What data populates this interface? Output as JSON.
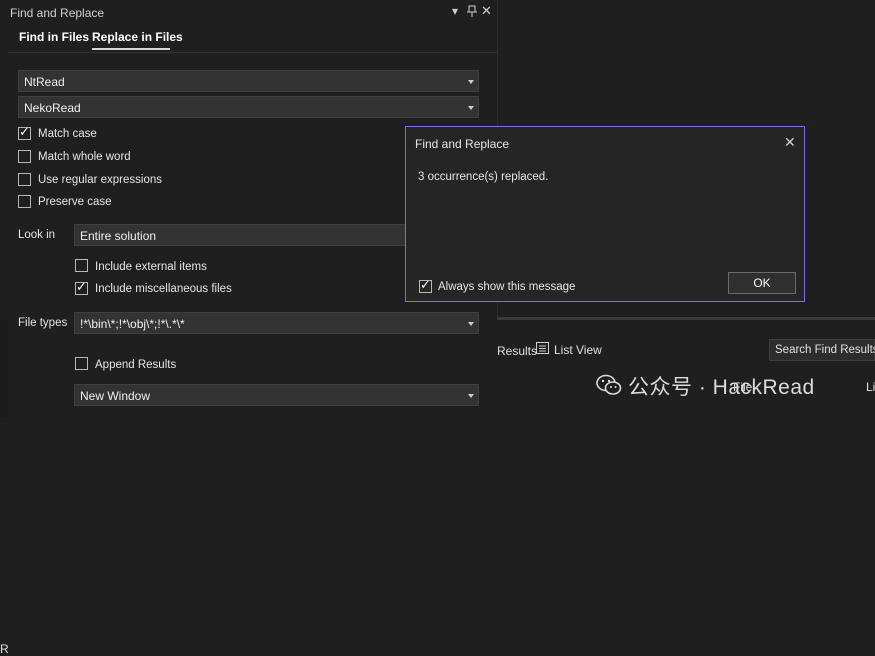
{
  "panel": {
    "title": "Find and Replace",
    "tabs": [
      "Find in Files",
      "Replace in Files"
    ],
    "find_value": "NtRead",
    "replace_value": "NekoRead",
    "options": [
      {
        "label": "Match case",
        "checked": true
      },
      {
        "label": "Match whole word",
        "checked": false
      },
      {
        "label": "Use regular expressions",
        "checked": false
      },
      {
        "label": "Preserve case",
        "checked": false
      }
    ],
    "look_in_label": "Look in",
    "look_in_value": "Entire solution",
    "include_external": {
      "label": "Include external items",
      "checked": false
    },
    "include_misc": {
      "label": "Include miscellaneous files",
      "checked": true
    },
    "file_types_label": "File types",
    "file_types_value": "!*\\bin\\*;!*\\obj\\*;!*\\.*\\*",
    "append_results": {
      "label": "Append Results",
      "checked": false
    },
    "output_value": "New Window"
  },
  "bottom": {
    "results_fragment": "Results",
    "list_view_label": "List View",
    "search_results_label": "Search Find Results",
    "file_column": "File",
    "edge_fragment_right": "Li",
    "edge_fragment_left": "R"
  },
  "dialog": {
    "title": "Find and Replace",
    "message": "3 occurrence(s) replaced.",
    "always_show_label": "Always show this message",
    "always_show_checked": true,
    "ok_label": "OK"
  },
  "watermark": {
    "text": "公众号 · HackRead"
  },
  "colors": {
    "background": "#1f1f1f",
    "dialog_border": "#7b6fdc",
    "combo_bg": "#333333"
  }
}
